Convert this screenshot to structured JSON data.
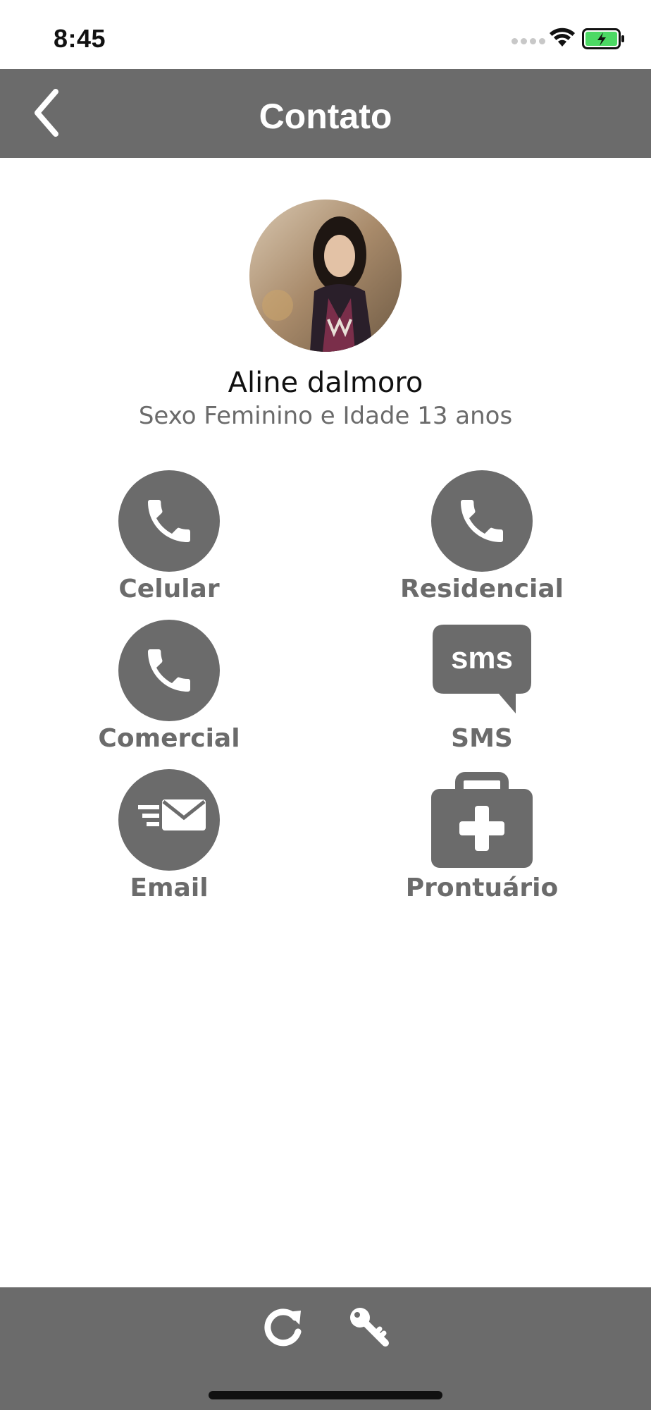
{
  "status_bar": {
    "time": "8:45"
  },
  "nav": {
    "title": "Contato"
  },
  "profile": {
    "name": "Aline dalmoro",
    "details": "Sexo Feminino e Idade 13 anos"
  },
  "actions": {
    "celular": {
      "label": "Celular",
      "icon": "phone-icon"
    },
    "residencial": {
      "label": "Residencial",
      "icon": "phone-icon"
    },
    "comercial": {
      "label": "Comercial",
      "icon": "phone-icon"
    },
    "sms": {
      "label": "SMS",
      "icon": "sms-bubble-icon",
      "icon_text": "sms"
    },
    "email": {
      "label": "Email",
      "icon": "email-icon"
    },
    "prontuario": {
      "label": "Prontuário",
      "icon": "medical-kit-icon"
    }
  },
  "colors": {
    "bar": "#6b6b6b",
    "icon": "#6b6b6b",
    "label": "#6b6b6b",
    "battery": "#4cd964"
  }
}
